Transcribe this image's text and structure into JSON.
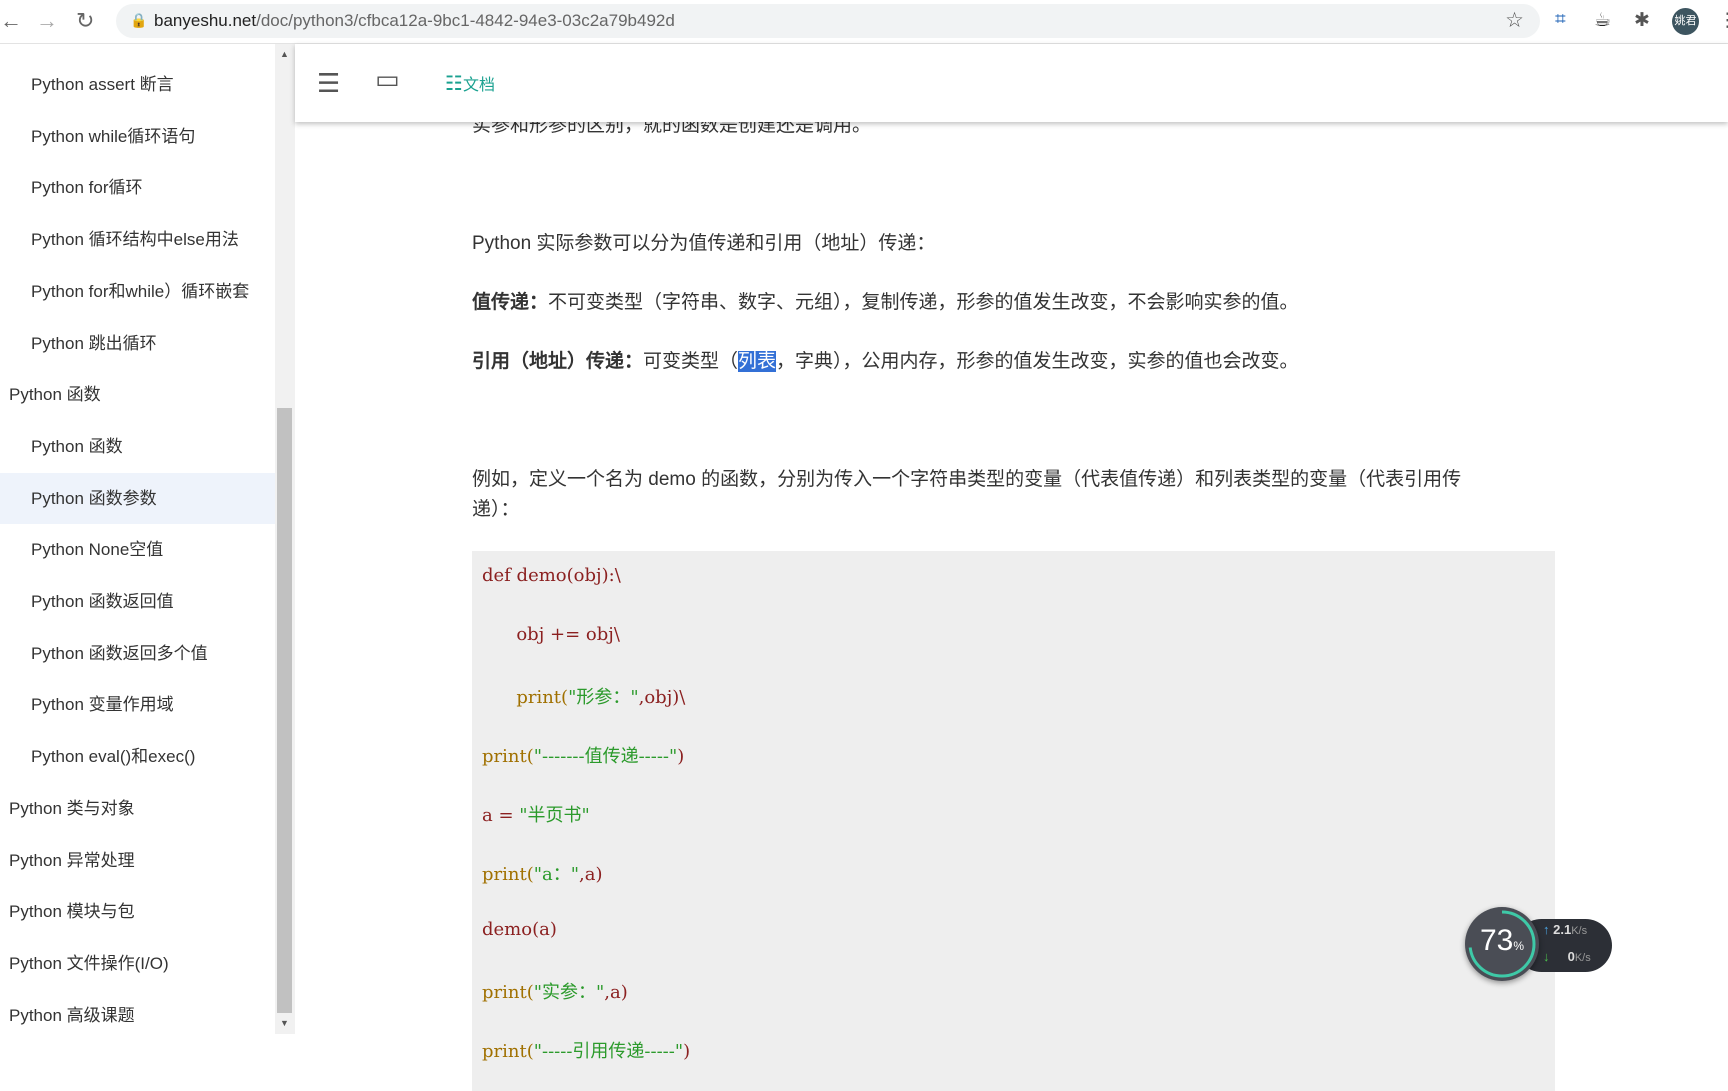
{
  "browser": {
    "url_host": "banyeshu.net",
    "url_path": "/doc/python3/cfbca12a-9bc1-4842-94e3-03c2a79b492d",
    "avatar": "姚君"
  },
  "sidebar": {
    "items": [
      {
        "label": "Python assert 断言",
        "level": "child"
      },
      {
        "label": "Python while循环语句",
        "level": "child"
      },
      {
        "label": "Python for循环",
        "level": "child"
      },
      {
        "label": "Python 循环结构中else用法",
        "level": "child"
      },
      {
        "label": "Python for和while）循环嵌套",
        "level": "child"
      },
      {
        "label": "Python 跳出循环",
        "level": "child"
      },
      {
        "label": "Python 函数",
        "level": "parent"
      },
      {
        "label": "Python 函数",
        "level": "child"
      },
      {
        "label": "Python 函数参数",
        "level": "child",
        "active": true
      },
      {
        "label": "Python None空值",
        "level": "child"
      },
      {
        "label": "Python 函数返回值",
        "level": "child"
      },
      {
        "label": "Python 函数返回多个值",
        "level": "child"
      },
      {
        "label": "Python 变量作用域",
        "level": "child"
      },
      {
        "label": "Python eval()和exec()",
        "level": "child"
      },
      {
        "label": "Python 类与对象",
        "level": "parent"
      },
      {
        "label": "Python 异常处理",
        "level": "parent"
      },
      {
        "label": "Python 模块与包",
        "level": "parent"
      },
      {
        "label": "Python 文件操作(I/O)",
        "level": "parent"
      },
      {
        "label": "Python 高级课题",
        "level": "parent"
      }
    ]
  },
  "toolbar": {
    "doc_label": "文档"
  },
  "content": {
    "cut_line": "实参和形参的区别，就的函数是创建还是调用。",
    "intro": "Python 实际参数可以分为值传递和引用（地址）传递：",
    "value_title": "值传递：",
    "value_text": "不可变类型（字符串、数字、元组），复制传递，形参的值发生改变，不会影响实参的值。",
    "ref_title": "引用（地址）传递：",
    "ref_pre": "可变类型（",
    "ref_hl": "列表",
    "ref_post": "，字典），公用内存，形参的值发生改变，实参的值也会改变。",
    "example_1": "例如，定义一个名为 demo 的函数，分别为传入一个字符串类型的变量（代表值传递）和列表类型的变量（代表引用传",
    "example_2": "递）："
  },
  "code": [
    [
      {
        "t": "def demo(obj):\\",
        "c": "k"
      }
    ],
    [
      {
        "t": "      obj += obj\\",
        "c": "k"
      }
    ],
    [
      {
        "t": "      print(",
        "c": "f"
      },
      {
        "t": "\"形参：\"",
        "c": "s"
      },
      {
        "t": ",obj)\\",
        "c": "k"
      }
    ],
    [
      {
        "t": "print(",
        "c": "f"
      },
      {
        "t": "\"-------值传递-----\"",
        "c": "s"
      },
      {
        "t": ")",
        "c": "k"
      }
    ],
    [
      {
        "t": "a = ",
        "c": "k"
      },
      {
        "t": "\"半页书\"",
        "c": "s"
      }
    ],
    [
      {
        "t": "print(",
        "c": "f"
      },
      {
        "t": "\"a：\"",
        "c": "s"
      },
      {
        "t": ",a)",
        "c": "k"
      }
    ],
    [
      {
        "t": "demo(a)",
        "c": "k"
      }
    ],
    [
      {
        "t": "print(",
        "c": "f"
      },
      {
        "t": "\"实参：\"",
        "c": "s"
      },
      {
        "t": ",a)",
        "c": "k"
      }
    ],
    [
      {
        "t": "print(",
        "c": "f"
      },
      {
        "t": "\"-----引用传递-----\"",
        "c": "s"
      },
      {
        "t": ")",
        "c": "k"
      }
    ]
  ],
  "widget": {
    "percent": "73",
    "percent_unit": "%",
    "up": "2.1",
    "up_unit": "K/s",
    "down": "0",
    "down_unit": "K/s"
  }
}
